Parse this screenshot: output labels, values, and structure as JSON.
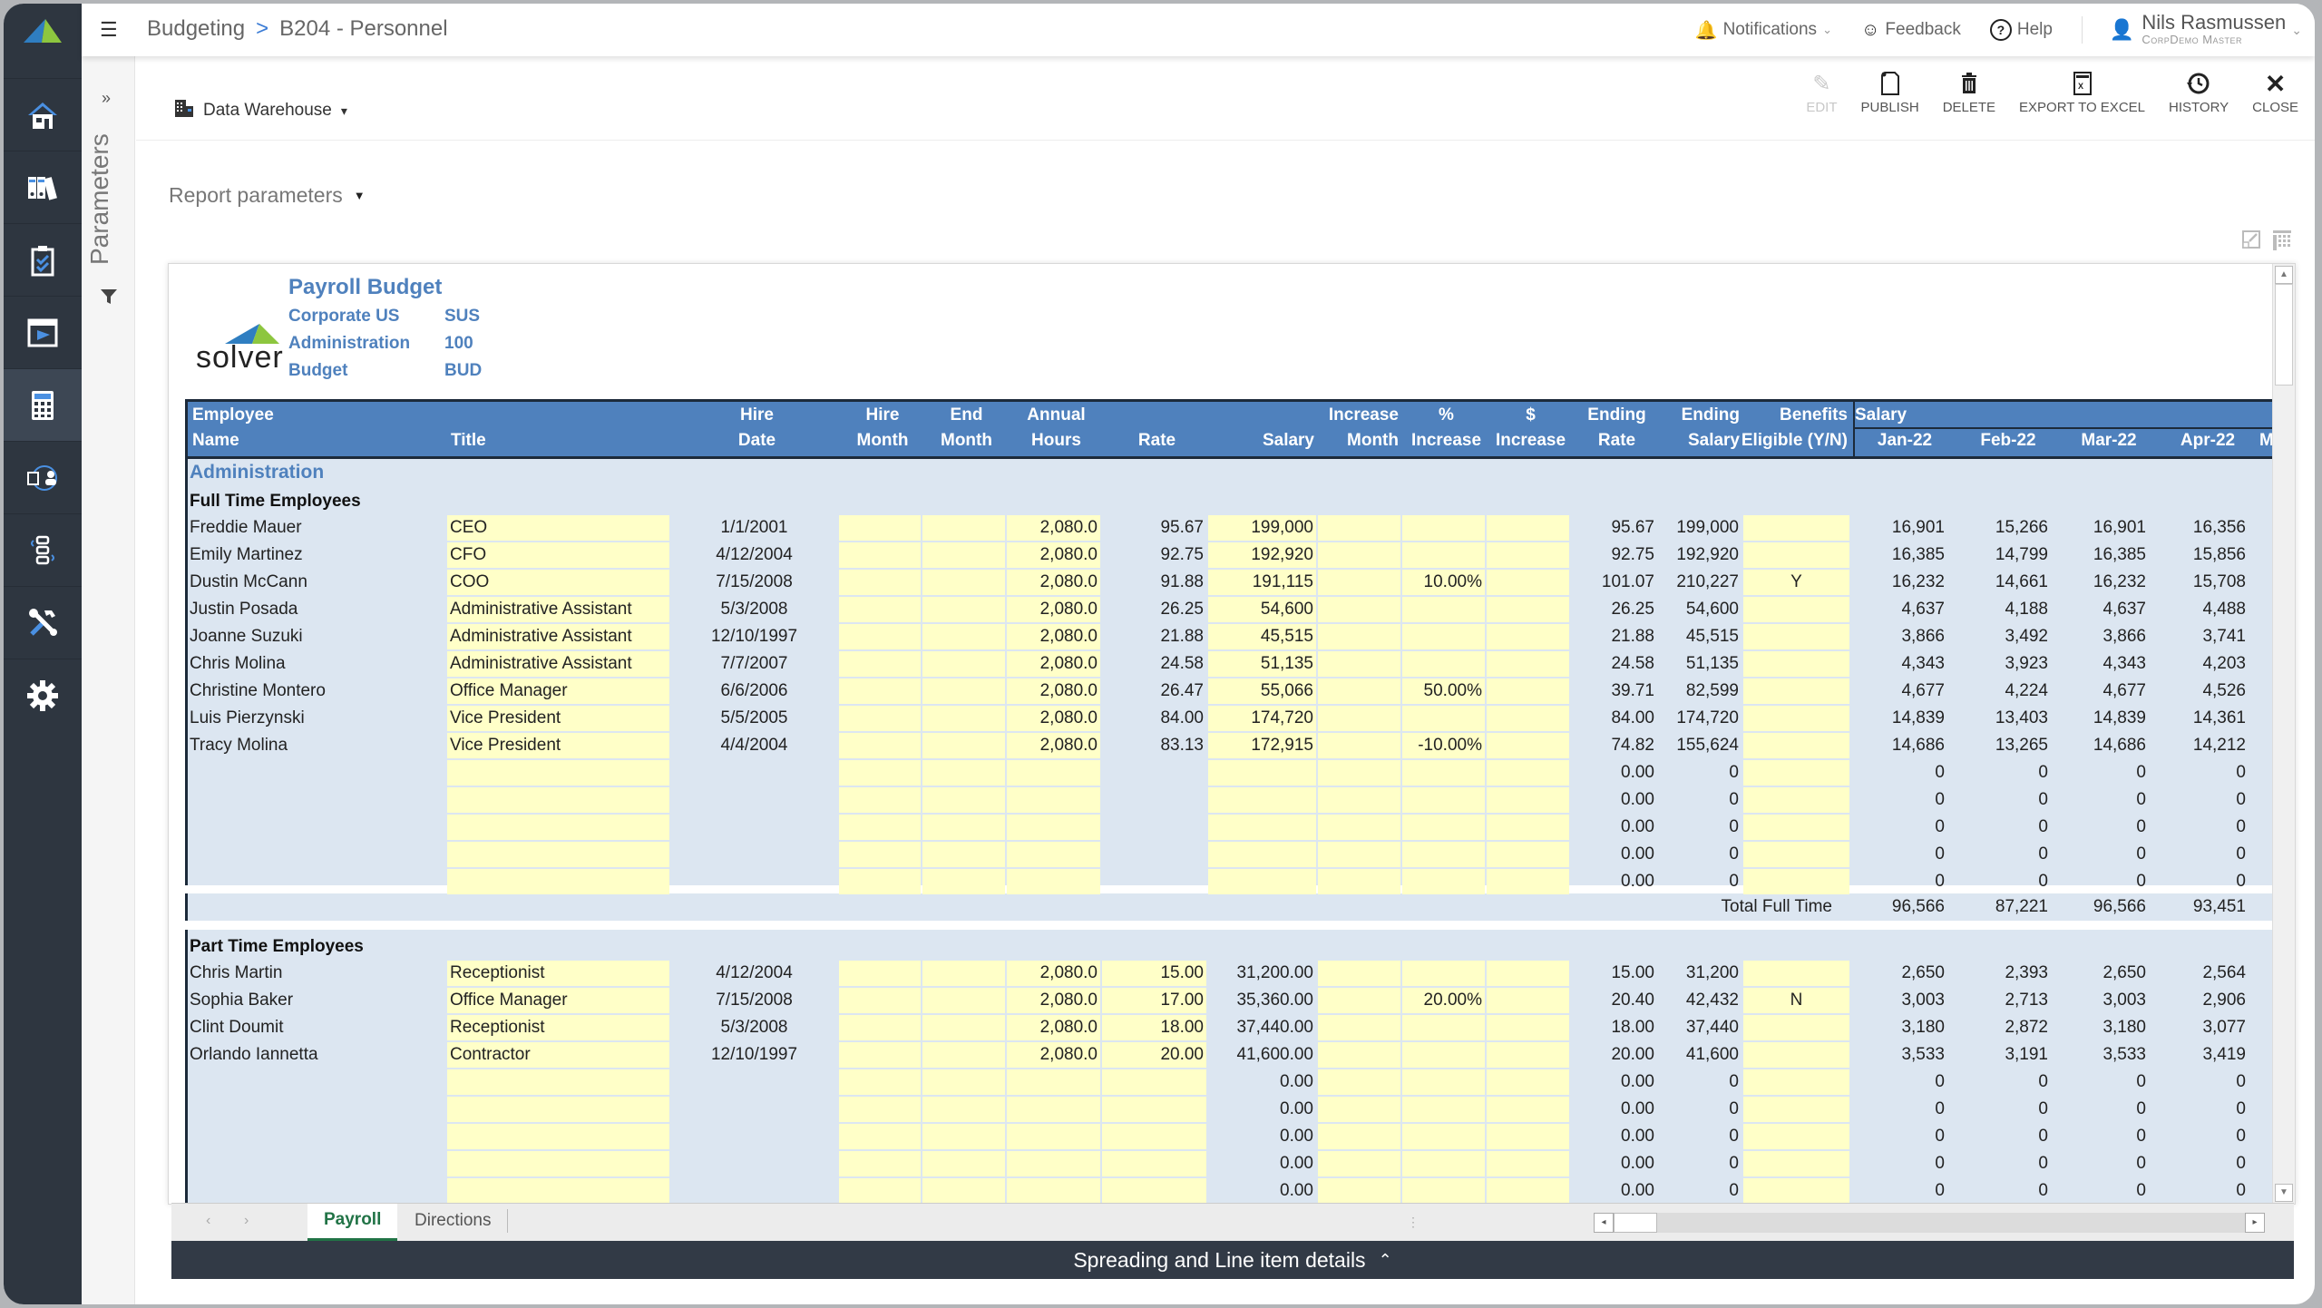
{
  "app": {
    "breadcrumb": [
      "Budgeting",
      "B204 - Personnel"
    ],
    "breadcrumb_separator": ">",
    "brand_color": "#4f81bd"
  },
  "topbar": {
    "notifications": "Notifications",
    "feedback": "Feedback",
    "help": "Help",
    "user_name": "Nils Rasmussen",
    "user_org": "CorpDemo Master"
  },
  "sidebar": {
    "items": [
      {
        "icon": "home-icon"
      },
      {
        "icon": "binders-icon"
      },
      {
        "icon": "clipboard-check-icon"
      },
      {
        "icon": "presentation-play-icon"
      },
      {
        "icon": "calculator-icon",
        "active": true
      },
      {
        "icon": "document-user-sync-icon"
      },
      {
        "icon": "workflow-icon"
      },
      {
        "icon": "tools-icon"
      },
      {
        "icon": "gear-icon"
      }
    ]
  },
  "params_panel": {
    "label": "Parameters",
    "expand": "»"
  },
  "toolbar": {
    "data_source": "Data Warehouse",
    "actions": {
      "edit": "EDIT",
      "publish": "PUBLISH",
      "delete": "DELETE",
      "export": "EXPORT TO EXCEL",
      "history": "HISTORY",
      "close": "CLOSE"
    },
    "report_params": "Report parameters"
  },
  "report": {
    "logo_text": "solver",
    "title": "Payroll Budget",
    "meta": [
      {
        "label": "Corporate US",
        "code": "SUS"
      },
      {
        "label": "Administration",
        "code": "100"
      },
      {
        "label": "Budget",
        "code": "BUD"
      }
    ],
    "headers": {
      "employee_name": [
        "Employee",
        "Name"
      ],
      "title": [
        "",
        "Title"
      ],
      "hire_date": [
        "Hire",
        "Date"
      ],
      "hire_month": [
        "Hire",
        "Month"
      ],
      "end_month": [
        "End",
        "Month"
      ],
      "annual_hours": [
        "Annual",
        "Hours"
      ],
      "rate": [
        "",
        "Rate"
      ],
      "salary": [
        "",
        "Salary"
      ],
      "increase_month": [
        "Increase",
        "Month"
      ],
      "pct_increase": [
        "%",
        "Increase"
      ],
      "dollar_increase": [
        "$",
        "Increase"
      ],
      "ending_rate": [
        "Ending",
        "Rate"
      ],
      "ending_salary": [
        "Ending",
        "Salary"
      ],
      "benefits": [
        "Benefits",
        "Eligible (Y/N)"
      ],
      "salary_group": "Salary",
      "months": [
        "Jan-22",
        "Feb-22",
        "Mar-22",
        "Apr-22",
        "M"
      ]
    },
    "section": "Administration",
    "full_time": {
      "label": "Full Time Employees",
      "rows": [
        {
          "name": "Freddie Mauer",
          "title": "CEO",
          "hire_date": "1/1/2001",
          "hours": "2,080.0",
          "rate": "95.67",
          "salary": "199,000",
          "pct": "",
          "end_rate": "95.67",
          "end_salary": "199,000",
          "benefits": "",
          "m": [
            "16,901",
            "15,266",
            "16,901",
            "16,356"
          ]
        },
        {
          "name": "Emily Martinez",
          "title": "CFO",
          "hire_date": "4/12/2004",
          "hours": "2,080.0",
          "rate": "92.75",
          "salary": "192,920",
          "pct": "",
          "end_rate": "92.75",
          "end_salary": "192,920",
          "benefits": "",
          "m": [
            "16,385",
            "14,799",
            "16,385",
            "15,856"
          ]
        },
        {
          "name": "Dustin McCann",
          "title": "COO",
          "hire_date": "7/15/2008",
          "hours": "2,080.0",
          "rate": "91.88",
          "salary": "191,115",
          "pct": "10.00%",
          "end_rate": "101.07",
          "end_salary": "210,227",
          "benefits": "Y",
          "m": [
            "16,232",
            "14,661",
            "16,232",
            "15,708"
          ]
        },
        {
          "name": "Justin Posada",
          "title": "Administrative Assistant",
          "hire_date": "5/3/2008",
          "hours": "2,080.0",
          "rate": "26.25",
          "salary": "54,600",
          "pct": "",
          "end_rate": "26.25",
          "end_salary": "54,600",
          "benefits": "",
          "m": [
            "4,637",
            "4,188",
            "4,637",
            "4,488"
          ]
        },
        {
          "name": "Joanne Suzuki",
          "title": "Administrative Assistant",
          "hire_date": "12/10/1997",
          "hours": "2,080.0",
          "rate": "21.88",
          "salary": "45,515",
          "pct": "",
          "end_rate": "21.88",
          "end_salary": "45,515",
          "benefits": "",
          "m": [
            "3,866",
            "3,492",
            "3,866",
            "3,741"
          ]
        },
        {
          "name": "Chris Molina",
          "title": "Administrative Assistant",
          "hire_date": "7/7/2007",
          "hours": "2,080.0",
          "rate": "24.58",
          "salary": "51,135",
          "pct": "",
          "end_rate": "24.58",
          "end_salary": "51,135",
          "benefits": "",
          "m": [
            "4,343",
            "3,923",
            "4,343",
            "4,203"
          ]
        },
        {
          "name": "Christine Montero",
          "title": "Office Manager",
          "hire_date": "6/6/2006",
          "hours": "2,080.0",
          "rate": "26.47",
          "salary": "55,066",
          "pct": "50.00%",
          "end_rate": "39.71",
          "end_salary": "82,599",
          "benefits": "",
          "m": [
            "4,677",
            "4,224",
            "4,677",
            "4,526"
          ]
        },
        {
          "name": "Luis Pierzynski",
          "title": "Vice President",
          "hire_date": "5/5/2005",
          "hours": "2,080.0",
          "rate": "84.00",
          "salary": "174,720",
          "pct": "",
          "end_rate": "84.00",
          "end_salary": "174,720",
          "benefits": "",
          "m": [
            "14,839",
            "13,403",
            "14,839",
            "14,361"
          ]
        },
        {
          "name": "Tracy Molina",
          "title": "Vice President",
          "hire_date": "4/4/2004",
          "hours": "2,080.0",
          "rate": "83.13",
          "salary": "172,915",
          "pct": "-10.00%",
          "end_rate": "74.82",
          "end_salary": "155,624",
          "benefits": "",
          "m": [
            "14,686",
            "13,265",
            "14,686",
            "14,212"
          ]
        },
        {
          "name": "",
          "title": "",
          "hire_date": "",
          "hours": "",
          "rate": "",
          "salary": "",
          "pct": "",
          "end_rate": "0.00",
          "end_salary": "0",
          "benefits": "",
          "m": [
            "0",
            "0",
            "0",
            "0"
          ]
        },
        {
          "name": "",
          "title": "",
          "hire_date": "",
          "hours": "",
          "rate": "",
          "salary": "",
          "pct": "",
          "end_rate": "0.00",
          "end_salary": "0",
          "benefits": "",
          "m": [
            "0",
            "0",
            "0",
            "0"
          ]
        },
        {
          "name": "",
          "title": "",
          "hire_date": "",
          "hours": "",
          "rate": "",
          "salary": "",
          "pct": "",
          "end_rate": "0.00",
          "end_salary": "0",
          "benefits": "",
          "m": [
            "0",
            "0",
            "0",
            "0"
          ]
        },
        {
          "name": "",
          "title": "",
          "hire_date": "",
          "hours": "",
          "rate": "",
          "salary": "",
          "pct": "",
          "end_rate": "0.00",
          "end_salary": "0",
          "benefits": "",
          "m": [
            "0",
            "0",
            "0",
            "0"
          ]
        },
        {
          "name": "",
          "title": "",
          "hire_date": "",
          "hours": "",
          "rate": "",
          "salary": "",
          "pct": "",
          "end_rate": "0.00",
          "end_salary": "0",
          "benefits": "",
          "m": [
            "0",
            "0",
            "0",
            "0"
          ]
        }
      ],
      "total_label": "Total Full Time",
      "totals": [
        "96,566",
        "87,221",
        "96,566",
        "93,451"
      ]
    },
    "part_time": {
      "label": "Part Time Employees",
      "rows": [
        {
          "name": "Chris Martin",
          "title": "Receptionist",
          "hire_date": "4/12/2004",
          "hours": "2,080.0",
          "rate": "15.00",
          "salary": "31,200.00",
          "pct": "",
          "end_rate": "15.00",
          "end_salary": "31,200",
          "benefits": "",
          "m": [
            "2,650",
            "2,393",
            "2,650",
            "2,564"
          ]
        },
        {
          "name": "Sophia Baker",
          "title": "Office Manager",
          "hire_date": "7/15/2008",
          "hours": "2,080.0",
          "rate": "17.00",
          "salary": "35,360.00",
          "pct": "20.00%",
          "end_rate": "20.40",
          "end_salary": "42,432",
          "benefits": "N",
          "m": [
            "3,003",
            "2,713",
            "3,003",
            "2,906"
          ]
        },
        {
          "name": "Clint Doumit",
          "title": "Receptionist",
          "hire_date": "5/3/2008",
          "hours": "2,080.0",
          "rate": "18.00",
          "salary": "37,440.00",
          "pct": "",
          "end_rate": "18.00",
          "end_salary": "37,440",
          "benefits": "",
          "m": [
            "3,180",
            "2,872",
            "3,180",
            "3,077"
          ]
        },
        {
          "name": "Orlando Iannetta",
          "title": "Contractor",
          "hire_date": "12/10/1997",
          "hours": "2,080.0",
          "rate": "20.00",
          "salary": "41,600.00",
          "pct": "",
          "end_rate": "20.00",
          "end_salary": "41,600",
          "benefits": "",
          "m": [
            "3,533",
            "3,191",
            "3,533",
            "3,419"
          ]
        },
        {
          "name": "",
          "title": "",
          "hire_date": "",
          "hours": "",
          "rate": "",
          "salary": "0.00",
          "pct": "",
          "end_rate": "0.00",
          "end_salary": "0",
          "benefits": "",
          "m": [
            "0",
            "0",
            "0",
            "0"
          ]
        },
        {
          "name": "",
          "title": "",
          "hire_date": "",
          "hours": "",
          "rate": "",
          "salary": "0.00",
          "pct": "",
          "end_rate": "0.00",
          "end_salary": "0",
          "benefits": "",
          "m": [
            "0",
            "0",
            "0",
            "0"
          ]
        },
        {
          "name": "",
          "title": "",
          "hire_date": "",
          "hours": "",
          "rate": "",
          "salary": "0.00",
          "pct": "",
          "end_rate": "0.00",
          "end_salary": "0",
          "benefits": "",
          "m": [
            "0",
            "0",
            "0",
            "0"
          ]
        },
        {
          "name": "",
          "title": "",
          "hire_date": "",
          "hours": "",
          "rate": "",
          "salary": "0.00",
          "pct": "",
          "end_rate": "0.00",
          "end_salary": "0",
          "benefits": "",
          "m": [
            "0",
            "0",
            "0",
            "0"
          ]
        },
        {
          "name": "",
          "title": "",
          "hire_date": "",
          "hours": "",
          "rate": "",
          "salary": "0.00",
          "pct": "",
          "end_rate": "0.00",
          "end_salary": "0",
          "benefits": "",
          "m": [
            "0",
            "0",
            "0",
            "0"
          ]
        }
      ]
    }
  },
  "sheet_tabs": {
    "tabs": [
      "Payroll",
      "Directions"
    ],
    "active": "Payroll"
  },
  "footer": {
    "label": "Spreading and Line item details"
  }
}
